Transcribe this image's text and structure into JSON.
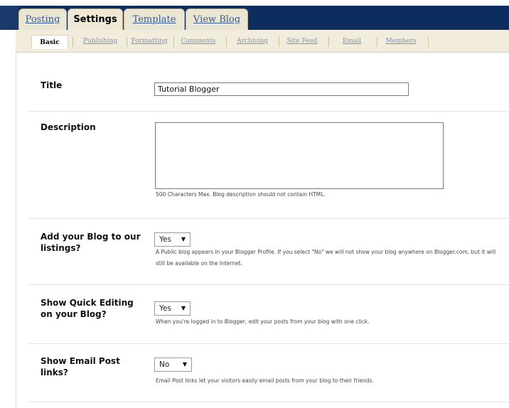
{
  "main_tabs": [
    {
      "label": "Posting"
    },
    {
      "label": "Settings"
    },
    {
      "label": "Template"
    },
    {
      "label": "View Blog"
    }
  ],
  "sub_tabs": [
    {
      "label": "Basic"
    },
    {
      "label": "Publishing"
    },
    {
      "label": "Formatting"
    },
    {
      "label": "Comments"
    },
    {
      "label": "Archiving"
    },
    {
      "label": "Site Feed"
    },
    {
      "label": "Email"
    },
    {
      "label": "Members"
    }
  ],
  "form": {
    "title": {
      "label": "Title",
      "value": "Tutorial Blogger"
    },
    "description": {
      "label": "Description",
      "value": "",
      "help": "500 Characters Max. Blog description should not contain HTML."
    },
    "listings": {
      "label": "Add your Blog to our listings?",
      "value": "Yes",
      "help": "A Public blog appears in your Blogger Profile. If you select \"No\" we will not show your blog anywhere on Blogger.com, but it will still be available on the Internet."
    },
    "quick_editing": {
      "label": "Show Quick Editing on your Blog?",
      "value": "Yes",
      "help": "When you're logged in to Blogger, edit your posts from your blog with one click."
    },
    "email_links": {
      "label": "Show Email Post links?",
      "value": "No",
      "help": "Email Post links let your visitors easily email posts from your blog to their friends."
    }
  },
  "icons": {
    "dropdown": "caret-down-icon"
  },
  "colors": {
    "navy_bar": "#0c2d5e",
    "tab_bg": "#ebe5d3",
    "link": "#3b5b8a"
  }
}
